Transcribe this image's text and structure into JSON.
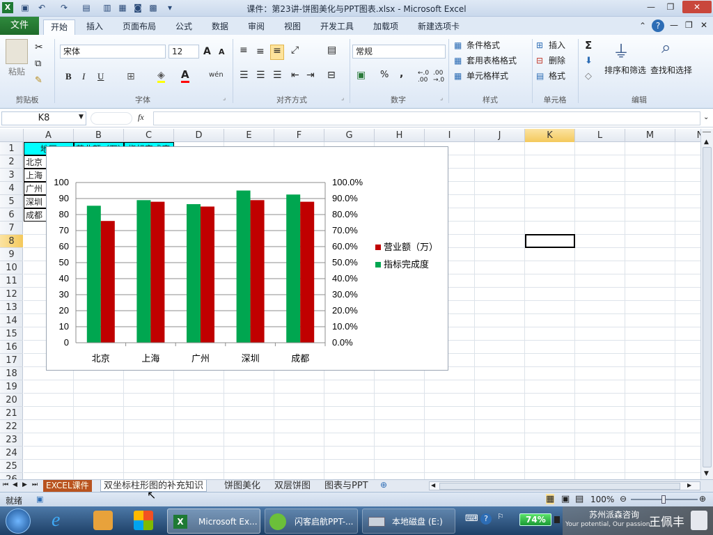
{
  "window": {
    "title": "课件：第23讲-饼图美化与PPT图表.xlsx - Microsoft Excel"
  },
  "ribbon_tabs": [
    "文件",
    "开始",
    "插入",
    "页面布局",
    "公式",
    "数据",
    "审阅",
    "视图",
    "开发工具",
    "加载项",
    "新建选项卡"
  ],
  "ribbon": {
    "clipboard": {
      "paste": "粘贴",
      "label": "剪贴板"
    },
    "font": {
      "name": "宋体",
      "size": "12",
      "label": "字体",
      "bold": "B",
      "italic": "I",
      "underline": "U",
      "grow": "A",
      "shrink": "A",
      "color_a": "A",
      "wen": "wén"
    },
    "alignment": {
      "label": "对齐方式"
    },
    "number": {
      "format": "常规",
      "label": "数字",
      "percent": "%",
      "comma": ",",
      "inc": "+.0\n.00",
      "dec": ".00\n+.0"
    },
    "styles": {
      "conditional": "条件格式",
      "table": "套用表格格式",
      "cell": "单元格样式",
      "label": "样式"
    },
    "cells": {
      "insert": "插入",
      "delete": "删除",
      "format": "格式",
      "label": "单元格"
    },
    "editing": {
      "sort": "排序和筛选",
      "find": "查找和选择",
      "label": "编辑",
      "sigma": "Σ"
    }
  },
  "formula_bar": {
    "name_box": "K8",
    "fx": "fx",
    "content": ""
  },
  "columns": [
    "A",
    "B",
    "C",
    "D",
    "E",
    "F",
    "G",
    "H",
    "I",
    "J",
    "K",
    "L",
    "M",
    "N"
  ],
  "rows": [
    "1",
    "2",
    "3",
    "4",
    "5",
    "6",
    "7",
    "8",
    "9",
    "10",
    "11",
    "12",
    "13",
    "14",
    "15",
    "16",
    "17",
    "18",
    "19",
    "20",
    "21",
    "22",
    "23",
    "24",
    "25",
    "26"
  ],
  "cells": {
    "A1": "地区",
    "B1": "营业额（万）",
    "C1": "指标完成度",
    "A2": "北京",
    "A3": "上海",
    "A4": "广州",
    "A5": "深圳",
    "A6": "成都"
  },
  "chart_data": {
    "type": "bar",
    "categories": [
      "北京",
      "上海",
      "广州",
      "深圳",
      "成都"
    ],
    "series": [
      {
        "name": "营业额（万）",
        "values": [
          76,
          88,
          85,
          89,
          88
        ],
        "color": "#c00000",
        "axis": "left"
      },
      {
        "name": "指标完成度",
        "values": [
          0.855,
          0.89,
          0.865,
          0.95,
          0.925
        ],
        "color": "#00a650",
        "axis": "right"
      }
    ],
    "y_left": {
      "min": 0,
      "max": 100,
      "step": 10,
      "ticks": [
        "0",
        "10",
        "20",
        "30",
        "40",
        "50",
        "60",
        "70",
        "80",
        "90",
        "100"
      ]
    },
    "y_right": {
      "min": 0,
      "max": 1,
      "step": 0.1,
      "ticks": [
        "0.0%",
        "10.0%",
        "20.0%",
        "30.0%",
        "40.0%",
        "50.0%",
        "60.0%",
        "70.0%",
        "80.0%",
        "90.0%",
        "100.0%"
      ]
    },
    "grid": true,
    "legend": "right",
    "legend_entries": [
      "营业额（万）",
      "指标完成度"
    ]
  },
  "sheet_tabs": [
    "EXCEL课件",
    "双坐标柱形图的补充知识",
    "饼图美化",
    "双层饼图",
    "图表与PPT"
  ],
  "active_sheet": "双坐标柱形图的补充知识",
  "status": {
    "mode": "就绪",
    "zoom": "100%"
  },
  "taskbar": {
    "items": [
      "Microsoft Ex...",
      "闪客启航PPT-...",
      "本地磁盘 (E:)"
    ],
    "battery": "74%",
    "brand": "苏州派森咨询",
    "slogan": "Your potential, Our passion!",
    "person": "王佩丰"
  },
  "colors": {
    "file_tab": "#1e6b2a",
    "header_fill": "#00ffff",
    "selection": "#000000"
  }
}
